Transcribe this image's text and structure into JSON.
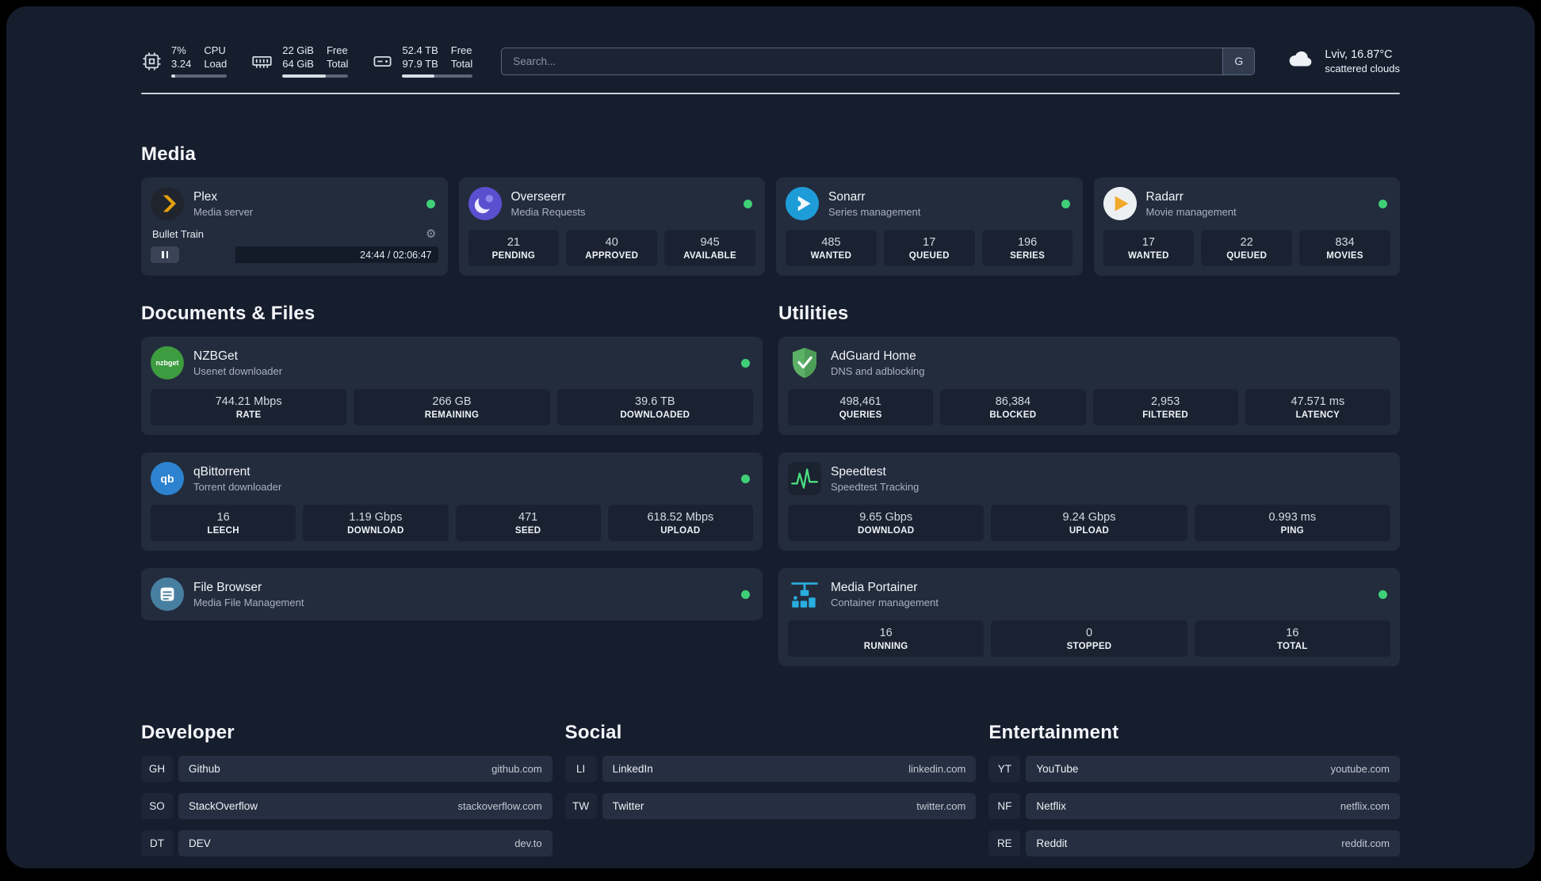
{
  "colors": {
    "status_online": "#3fcf77",
    "plex_accent": "#e5a00d",
    "adguard_green": "#5cb066",
    "speedtest_green": "#4ade80",
    "portainer_blue": "#29aee0"
  },
  "topbar": {
    "cpu": {
      "value_top": "7%",
      "value_bottom": "3.24",
      "label_top": "CPU",
      "label_bottom": "Load"
    },
    "ram": {
      "value_top": "22 GiB",
      "value_bottom": "64 GiB",
      "label_top": "Free",
      "label_bottom": "Total"
    },
    "disk": {
      "value_top": "52.4 TB",
      "value_bottom": "97.9 TB",
      "label_top": "Free",
      "label_bottom": "Total"
    },
    "search": {
      "placeholder": "Search...",
      "button": "G"
    },
    "weather": {
      "location": "Lviv, 16.87°C",
      "condition": "scattered clouds"
    }
  },
  "sections": {
    "media": "Media",
    "documents": "Documents & Files",
    "utilities": "Utilities",
    "developer": "Developer",
    "social": "Social",
    "entertainment": "Entertainment"
  },
  "media": {
    "plex": {
      "name": "Plex",
      "subtitle": "Media server",
      "now_playing": "Bullet Train",
      "time": "24:44 / 02:06:47"
    },
    "overseerr": {
      "name": "Overseerr",
      "subtitle": "Media Requests",
      "stats": [
        {
          "value": "21",
          "label": "PENDING"
        },
        {
          "value": "40",
          "label": "APPROVED"
        },
        {
          "value": "945",
          "label": "AVAILABLE"
        }
      ]
    },
    "sonarr": {
      "name": "Sonarr",
      "subtitle": "Series management",
      "stats": [
        {
          "value": "485",
          "label": "WANTED"
        },
        {
          "value": "17",
          "label": "QUEUED"
        },
        {
          "value": "196",
          "label": "SERIES"
        }
      ]
    },
    "radarr": {
      "name": "Radarr",
      "subtitle": "Movie management",
      "stats": [
        {
          "value": "17",
          "label": "WANTED"
        },
        {
          "value": "22",
          "label": "QUEUED"
        },
        {
          "value": "834",
          "label": "MOVIES"
        }
      ]
    }
  },
  "documents": {
    "nzbget": {
      "name": "NZBGet",
      "subtitle": "Usenet downloader",
      "icon_text": "nzbget",
      "stats": [
        {
          "value": "744.21 Mbps",
          "label": "RATE"
        },
        {
          "value": "266 GB",
          "label": "REMAINING"
        },
        {
          "value": "39.6 TB",
          "label": "DOWNLOADED"
        }
      ]
    },
    "qbittorrent": {
      "name": "qBittorrent",
      "subtitle": "Torrent downloader",
      "icon_text": "qb",
      "stats": [
        {
          "value": "16",
          "label": "LEECH"
        },
        {
          "value": "1.19 Gbps",
          "label": "DOWNLOAD"
        },
        {
          "value": "471",
          "label": "SEED"
        },
        {
          "value": "618.52 Mbps",
          "label": "UPLOAD"
        }
      ]
    },
    "filebrowser": {
      "name": "File Browser",
      "subtitle": "Media File Management"
    }
  },
  "utilities": {
    "adguard": {
      "name": "AdGuard Home",
      "subtitle": "DNS and adblocking",
      "stats": [
        {
          "value": "498,461",
          "label": "QUERIES"
        },
        {
          "value": "86,384",
          "label": "BLOCKED"
        },
        {
          "value": "2,953",
          "label": "FILTERED"
        },
        {
          "value": "47.571 ms",
          "label": "LATENCY"
        }
      ]
    },
    "speedtest": {
      "name": "Speedtest",
      "subtitle": "Speedtest Tracking",
      "stats": [
        {
          "value": "9.65 Gbps",
          "label": "DOWNLOAD"
        },
        {
          "value": "9.24 Gbps",
          "label": "UPLOAD"
        },
        {
          "value": "0.993 ms",
          "label": "PING"
        }
      ]
    },
    "portainer": {
      "name": "Media Portainer",
      "subtitle": "Container management",
      "stats": [
        {
          "value": "16",
          "label": "RUNNING"
        },
        {
          "value": "0",
          "label": "STOPPED"
        },
        {
          "value": "16",
          "label": "TOTAL"
        }
      ]
    }
  },
  "bookmarks": {
    "developer": [
      {
        "abbr": "GH",
        "name": "Github",
        "url": "github.com"
      },
      {
        "abbr": "SO",
        "name": "StackOverflow",
        "url": "stackoverflow.com"
      },
      {
        "abbr": "DT",
        "name": "DEV",
        "url": "dev.to"
      }
    ],
    "social": [
      {
        "abbr": "LI",
        "name": "LinkedIn",
        "url": "linkedin.com"
      },
      {
        "abbr": "TW",
        "name": "Twitter",
        "url": "twitter.com"
      }
    ],
    "entertainment": [
      {
        "abbr": "YT",
        "name": "YouTube",
        "url": "youtube.com"
      },
      {
        "abbr": "NF",
        "name": "Netflix",
        "url": "netflix.com"
      },
      {
        "abbr": "RE",
        "name": "Reddit",
        "url": "reddit.com"
      }
    ]
  }
}
